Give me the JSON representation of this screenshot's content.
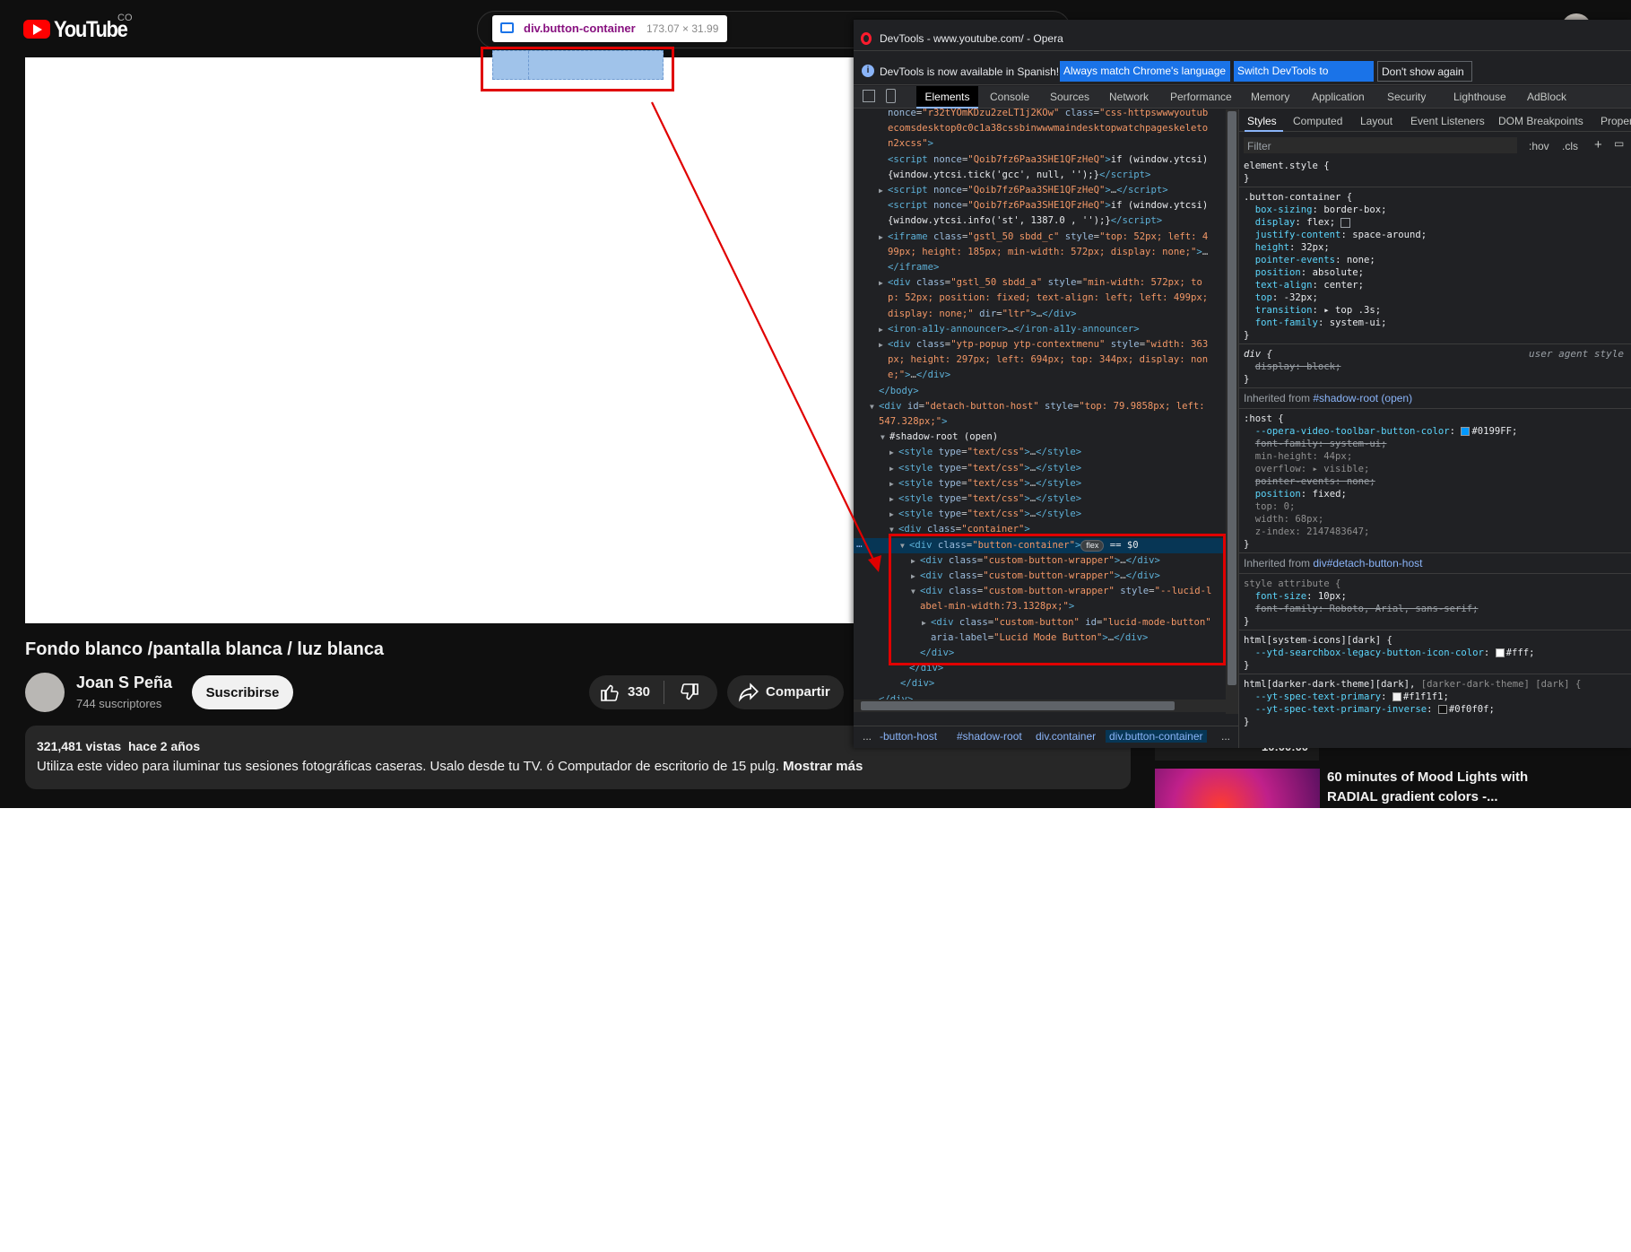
{
  "youtube": {
    "logo_text": "YouTube",
    "country_code": "CO",
    "video": {
      "title": "Fondo blanco /pantalla blanca / luz blanca",
      "channel_name": "Joan S Peña",
      "channel_subs": "744 suscriptores",
      "subscribe_label": "Suscribirse",
      "likes": "330",
      "share_label": "Compartir",
      "views_meta": "321,481 vistas  hace 2 años",
      "description": "Utiliza este video para iluminar tus sesiones fotográficas caseras. Usalo desde tu TV. ó Computador de escritorio de 15 pulg.",
      "more_label": "Mostrar más"
    },
    "sidebar": {
      "duration": "10:00:00",
      "next_title": "60 minutes of Mood Lights with RADIAL gradient colors -..."
    }
  },
  "inspector": {
    "tooltip_name": "div.button-container",
    "tooltip_size": "173.07 × 31.99",
    "highlight_color": "#a0c3ea",
    "annotation_color": "#e00000"
  },
  "devtools": {
    "window_title": "DevTools - www.youtube.com/ - Opera",
    "info_text": "DevTools is now available in Spanish!",
    "btn_match": "Always match Chrome's language",
    "btn_switch": "Switch DevTools to Spanish",
    "btn_dismiss": "Don't show again",
    "tabs": [
      "Elements",
      "Console",
      "Sources",
      "Network",
      "Performance",
      "Memory",
      "Application",
      "Security",
      "Lighthouse",
      "AdBlock"
    ],
    "styles_tabs": [
      "Styles",
      "Computed",
      "Layout",
      "Event Listeners",
      "DOM Breakpoints",
      "Proper"
    ],
    "filter_placeholder": "Filter",
    "hov_label": ":hov",
    "cls_label": ".cls",
    "breadcrumbs": [
      "...",
      "-button-host",
      "#shadow-root",
      "div.container",
      "div.button-container",
      "..."
    ],
    "elements_lines": [
      {
        "html": "<span class=\"at\">nonce</span>=<span class=\"av\">\"r32tYOmKDzu2zeLT1j2KOw\"</span> <span class=\"at\">class</span>=<span class=\"av\">\"css-httpswwwyoutub</span>"
      },
      {
        "html": "<span class=\"av\">ecomsdesktop0c0c1a38cssbinwwwmaindesktopwatchpageskeleto</span>"
      },
      {
        "html": "<span class=\"av\">n2xcss\"</span><span class=\"tg\">&gt;</span>"
      },
      {
        "html": "<span class=\"tg\">&lt;script</span> <span class=\"at\">nonce</span>=<span class=\"av\">\"Qoib7fz6Paa3SHE1QFzHeQ\"</span><span class=\"tg\">&gt;</span><span class=\"txt\">if (window.ytcsi)</span>"
      },
      {
        "html": "<span class=\"txt\">{window.ytcsi.tick('gcc', null, '');}</span><span class=\"tg\">&lt;/script&gt;</span>"
      },
      {
        "html": "<span class=\"tg\">&lt;script</span> <span class=\"at\">nonce</span>=<span class=\"av\">\"Qoib7fz6Paa3SHE1QFzHeQ\"</span><span class=\"tg\">&gt;</span>…<span class=\"tg\">&lt;/script&gt;</span>"
      },
      {
        "html": "<span class=\"tg\">&lt;script</span> <span class=\"at\">nonce</span>=<span class=\"av\">\"Qoib7fz6Paa3SHE1QFzHeQ\"</span><span class=\"tg\">&gt;</span><span class=\"txt\">if (window.ytcsi)</span>"
      },
      {
        "html": "<span class=\"txt\">{window.ytcsi.info('st', 1387.0 , '');}</span><span class=\"tg\">&lt;/script&gt;</span>"
      },
      {
        "html": "<span class=\"tg\">&lt;iframe</span> <span class=\"at\">class</span>=<span class=\"av\">\"gstl_50 sbdd_c\"</span> <span class=\"at\">style</span>=<span class=\"av\">\"top: 52px; left: 4</span>"
      },
      {
        "html": "<span class=\"av\">99px; height: 185px; min-width: 572px; display: none;\"</span><span class=\"tg\">&gt;</span>…"
      },
      {
        "html": "<span class=\"tg\">&lt;/iframe&gt;</span>"
      },
      {
        "html": "<span class=\"tg\">&lt;div</span> <span class=\"at\">class</span>=<span class=\"av\">\"gstl_50 sbdd_a\"</span> <span class=\"at\">style</span>=<span class=\"av\">\"min-width: 572px; to</span>"
      },
      {
        "html": "<span class=\"av\">p: 52px; position: fixed; text-align: left; left: 499px;</span>"
      },
      {
        "html": "<span class=\"av\">display: none;\"</span> <span class=\"at\">dir</span>=<span class=\"av\">\"ltr\"</span><span class=\"tg\">&gt;</span>…<span class=\"tg\">&lt;/div&gt;</span>"
      },
      {
        "html": "<span class=\"tg\">&lt;iron-a11y-announcer&gt;</span>…<span class=\"tg\">&lt;/iron-a11y-announcer&gt;</span>"
      },
      {
        "html": "<span class=\"tg\">&lt;div</span> <span class=\"at\">class</span>=<span class=\"av\">\"ytp-popup ytp-contextmenu\"</span> <span class=\"at\">style</span>=<span class=\"av\">\"width: 363</span>"
      },
      {
        "html": "<span class=\"av\">px; height: 297px; left: 694px; top: 344px; display: non</span>"
      },
      {
        "html": "<span class=\"av\">e;\"</span><span class=\"tg\">&gt;</span>…<span class=\"tg\">&lt;/div&gt;</span>"
      },
      {
        "html": "<span class=\"tg\">&lt;/body&gt;</span>"
      },
      {
        "html": "<span class=\"tg\">&lt;div</span> <span class=\"at\">id</span>=<span class=\"av\">\"detach-button-host\"</span> <span class=\"at\">style</span>=<span class=\"av\">\"top: 79.9858px; left:</span>"
      },
      {
        "html": "<span class=\"av\">547.328px;\"</span><span class=\"tg\">&gt;</span>"
      },
      {
        "html": "<span class=\"txt\">#shadow-root (open)</span>"
      },
      {
        "html": "<span class=\"tg\">&lt;style</span> <span class=\"at\">type</span>=<span class=\"av\">\"text/css\"</span><span class=\"tg\">&gt;</span>…<span class=\"tg\">&lt;/style&gt;</span>"
      },
      {
        "html": "<span class=\"tg\">&lt;style</span> <span class=\"at\">type</span>=<span class=\"av\">\"text/css\"</span><span class=\"tg\">&gt;</span>…<span class=\"tg\">&lt;/style&gt;</span>"
      },
      {
        "html": "<span class=\"tg\">&lt;style</span> <span class=\"at\">type</span>=<span class=\"av\">\"text/css\"</span><span class=\"tg\">&gt;</span>…<span class=\"tg\">&lt;/style&gt;</span>"
      },
      {
        "html": "<span class=\"tg\">&lt;style</span> <span class=\"at\">type</span>=<span class=\"av\">\"text/css\"</span><span class=\"tg\">&gt;</span>…<span class=\"tg\">&lt;/style&gt;</span>"
      },
      {
        "html": "<span class=\"tg\">&lt;style</span> <span class=\"at\">type</span>=<span class=\"av\">\"text/css\"</span><span class=\"tg\">&gt;</span>…<span class=\"tg\">&lt;/style&gt;</span>"
      },
      {
        "html": "<span class=\"tg\">&lt;div</span> <span class=\"at\">class</span>=<span class=\"av\">\"container\"</span><span class=\"tg\">&gt;</span>"
      },
      {
        "html": "<span class=\"tg\">&lt;div</span> <span class=\"at\">class</span>=<span class=\"av\">\"button-container\"</span><span class=\"tg\">&gt;</span><span class=\"flexbadge\">flex</span> <span class=\"txt\">== $0</span>"
      },
      {
        "html": "<span class=\"tg\">&lt;div</span> <span class=\"at\">class</span>=<span class=\"av\">\"custom-button-wrapper\"</span><span class=\"tg\">&gt;</span>…<span class=\"tg\">&lt;/div&gt;</span>"
      },
      {
        "html": "<span class=\"tg\">&lt;div</span> <span class=\"at\">class</span>=<span class=\"av\">\"custom-button-wrapper\"</span><span class=\"tg\">&gt;</span>…<span class=\"tg\">&lt;/div&gt;</span>"
      },
      {
        "html": "<span class=\"tg\">&lt;div</span> <span class=\"at\">class</span>=<span class=\"av\">\"custom-button-wrapper\"</span> <span class=\"at\">style</span>=<span class=\"av\">\"--lucid-l</span>"
      },
      {
        "html": "<span class=\"av\">abel-min-width:73.1328px;\"</span><span class=\"tg\">&gt;</span>"
      },
      {
        "html": "<span class=\"tg\">&lt;div</span> <span class=\"at\">class</span>=<span class=\"av\">\"custom-button\"</span> <span class=\"at\">id</span>=<span class=\"av\">\"lucid-mode-button\"</span>"
      },
      {
        "html": "<span class=\"at\">aria-label</span>=<span class=\"av\">\"Lucid Mode Button\"</span><span class=\"tg\">&gt;</span>…<span class=\"tg\">&lt;/div&gt;</span>"
      },
      {
        "html": "<span class=\"tg\">&lt;/div&gt;</span>"
      },
      {
        "html": "<span class=\"tg\">&lt;/div&gt;</span>"
      },
      {
        "html": "<span class=\"tg\">&lt;/div&gt;</span>"
      },
      {
        "html": "<span class=\"tg\">&lt;/div&gt;</span>"
      }
    ],
    "styles": {
      "element_style": "element.style {",
      "rule1_selector": ".button-container {",
      "rule1_props": [
        [
          "box-sizing",
          "border-box;"
        ],
        [
          "display",
          "flex;"
        ],
        [
          "justify-content",
          "space-around;"
        ],
        [
          "height",
          "32px;"
        ],
        [
          "pointer-events",
          "none;"
        ],
        [
          "position",
          "absolute;"
        ],
        [
          "text-align",
          "center;"
        ],
        [
          "top",
          "-32px;"
        ],
        [
          "transition",
          "top .3s;"
        ],
        [
          "font-family",
          "system-ui;"
        ]
      ],
      "ua_selector": "div {",
      "ua_label": "user agent style",
      "ua_prop": "display: block;",
      "inherited1_label": "Inherited from",
      "inherited1_target": "#shadow-root (open)",
      "host_selector": ":host {",
      "host_props": [
        [
          "--opera-video-toolbar-button-color",
          "#0199FF;"
        ],
        [
          "font-family",
          "system-ui;"
        ],
        [
          "min-height",
          "44px;"
        ],
        [
          "overflow",
          "visible;"
        ],
        [
          "pointer-events",
          "none;"
        ],
        [
          "position",
          "fixed;"
        ],
        [
          "top",
          "0;"
        ],
        [
          "width",
          "68px;"
        ],
        [
          "z-index",
          "2147483647;"
        ]
      ],
      "swatch_blue": "#0199FF",
      "inherited2_label": "Inherited from",
      "inherited2_target": "div#detach-button-host",
      "style_attr_selector": "style attribute {",
      "style_attr_props": [
        [
          "font-size",
          "10px;"
        ],
        [
          "font-family",
          "Roboto, Arial, sans-serif;"
        ]
      ],
      "rule_sysicons_selector": "html[system-icons][dark] {",
      "rule_sysicons_prop": [
        "--ytd-searchbox-legacy-button-icon-color",
        "#fff;"
      ],
      "swatch_white": "#ffffff",
      "rule_dark_selector": "html[darker-dark-theme][dark],",
      "rule_dark_selector_dim": "[darker-dark-theme] [dark] {",
      "rule_dark_props": [
        [
          "--yt-spec-text-primary",
          "#f1f1f1;"
        ],
        [
          "--yt-spec-text-primary-inverse",
          "#0f0f0f;"
        ]
      ],
      "swatch_dark": "#0f0f0f"
    }
  }
}
